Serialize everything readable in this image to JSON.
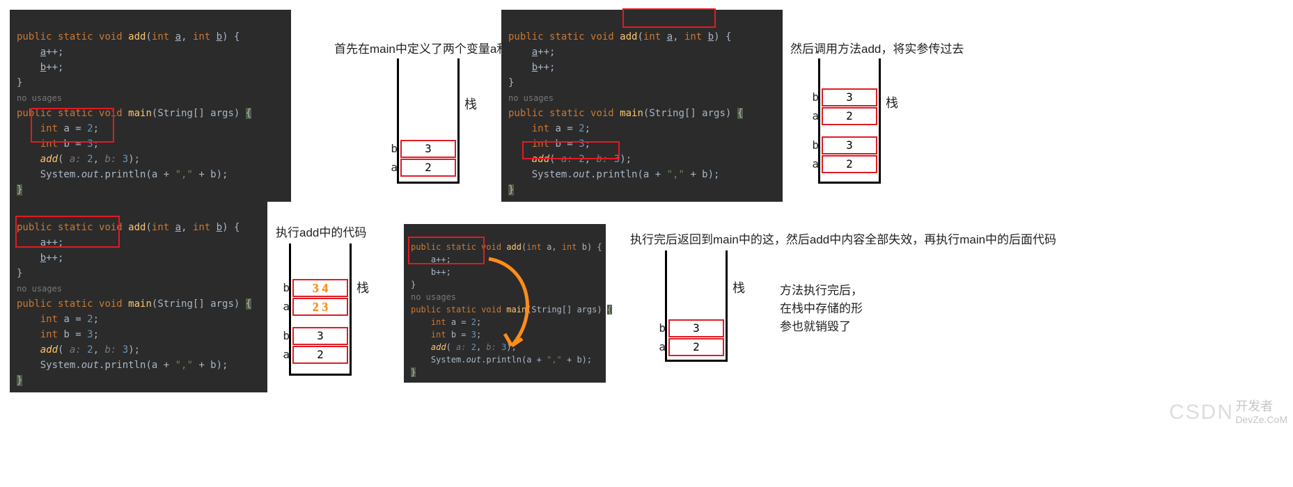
{
  "code": {
    "add_sig_open": "public static void add(int a, int b) {",
    "add_body1": "    a++;",
    "add_body2": "    b++;",
    "close": "}",
    "no_usages": "no usages",
    "main_sig_open": "public static void main(String[] args) {",
    "int_a": "    int a = 2;",
    "int_b": "    int b = 3;",
    "call_add": "    add( a: 2, b: 3);",
    "println": "    System.out.println(a + \",\" + b);",
    "close_brace": "}"
  },
  "captions": {
    "c1": "首先在main中定义了两个变量a和b",
    "c2": "然后调用方法add，将实参传过去",
    "c3": "执行add中的代码",
    "c4": "执行完后返回到main中的这，然后add中内容全部失效，再执行main中的后面代码",
    "c5": "方法执行完后，在栈中存储的形参也就销毁了"
  },
  "stack": {
    "label_title": "栈",
    "a": "a",
    "b": "b",
    "val2": "2",
    "val3": "3",
    "scratch_top": "3 4",
    "scratch_bot": "2 3"
  },
  "watermark": {
    "csdn": "CSDN",
    "devze": "开发者",
    "devze_en": "DevZe.CoM"
  }
}
